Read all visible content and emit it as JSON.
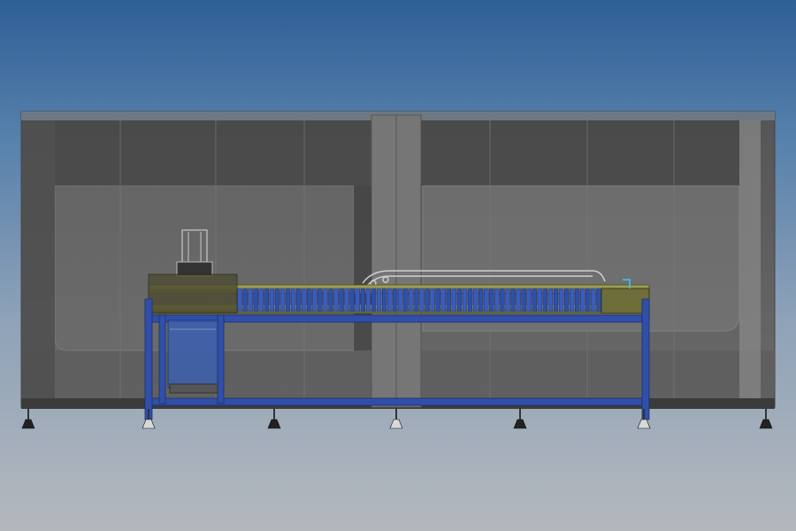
{
  "view": {
    "kind": "CAD side elevation render",
    "background_colors": {
      "top": "#2f5f97",
      "bottom": "#b4b8bd"
    },
    "enclosure_color": "#5e5e5e",
    "frame_color": "#2f4fa8",
    "rail_color": "#8a8a3a",
    "accent_color": "#41b6d6"
  },
  "scene": {
    "enclosure": {
      "label": "machine-enclosure",
      "panel_count": 8
    },
    "conveyor": {
      "label": "conveyor-assembly",
      "carrier_count": 68
    },
    "feet": {
      "count": 7
    }
  }
}
